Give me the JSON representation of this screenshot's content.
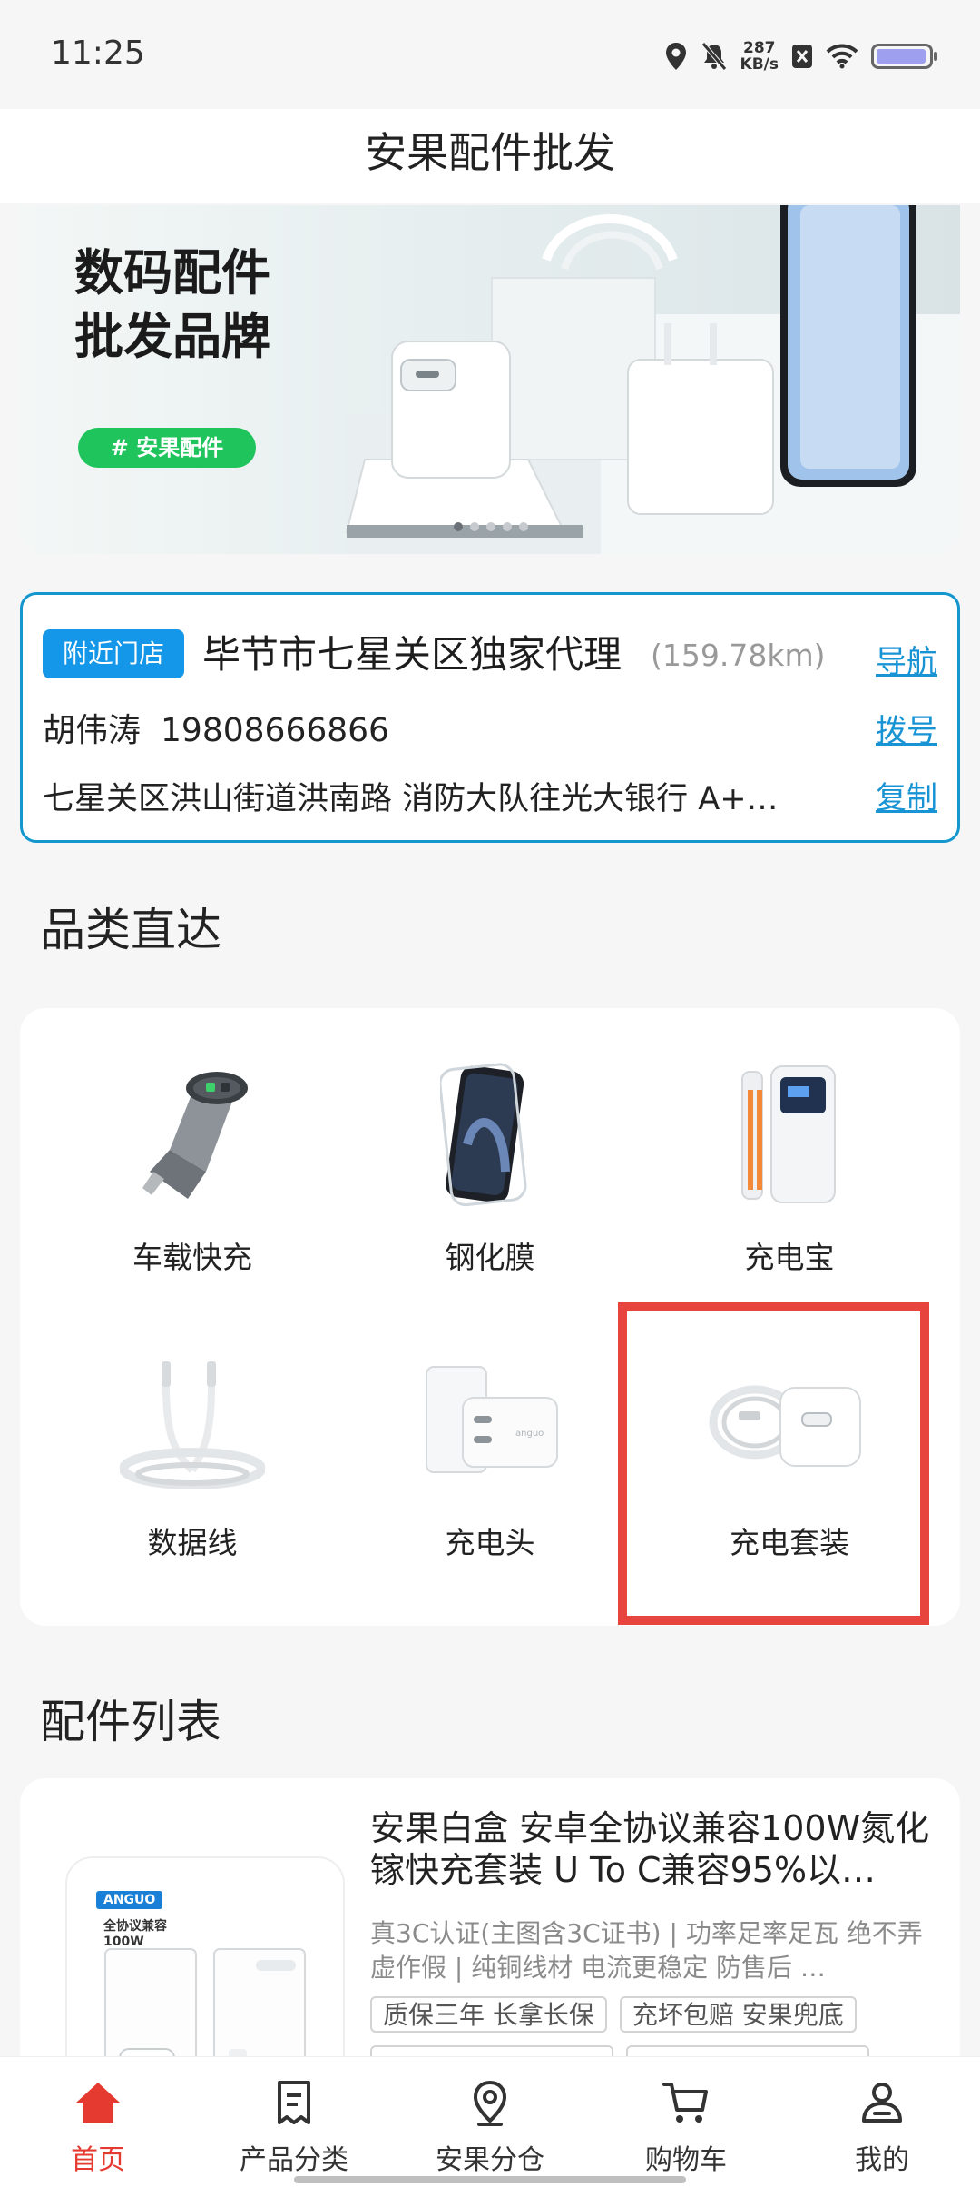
{
  "status_bar": {
    "time": "11:25",
    "speed_value": "287",
    "speed_unit": "KB/s"
  },
  "header": {
    "title": "安果配件批发"
  },
  "banner": {
    "headline": "数码配件\n批发品牌",
    "tag": "# 安果配件",
    "slide_count": 5,
    "active_slide": 1
  },
  "store": {
    "badge": "附近门店",
    "name": "毕节市七星关区独家代理",
    "distance": "(159.78km)",
    "nav_link": "导航",
    "contact_name": "胡伟涛",
    "phone": "19808666866",
    "dial_link": "拨号",
    "address": "七星关区洪山街道洪南路 消防大队往光大银行  A+…",
    "copy_link": "复制"
  },
  "categories": {
    "title": "品类直达",
    "items": [
      {
        "label": "车载快充",
        "icon": "car-charger-icon"
      },
      {
        "label": "钢化膜",
        "icon": "tempered-glass-icon"
      },
      {
        "label": "充电宝",
        "icon": "power-bank-icon"
      },
      {
        "label": "数据线",
        "icon": "data-cable-icon"
      },
      {
        "label": "充电头",
        "icon": "charger-head-icon"
      },
      {
        "label": "充电套装",
        "icon": "charging-set-icon"
      }
    ]
  },
  "products": {
    "title": "配件列表",
    "items": [
      {
        "image_brand": "ANGUO",
        "image_caption": "全协议兼容\n100W",
        "title": "安果白盒 安卓全协议兼容100W氮化镓快充套装 U To C兼容95%以…",
        "desc": "真3C认证(主图含3C证书) | 功率足率足瓦 绝不弄虚作假 | 纯铜线材 电流更稳定 防售后 …",
        "tags": [
          "质保三年 长拿长保",
          "充坏包赔 安果兜底"
        ]
      }
    ]
  },
  "tabbar": {
    "items": [
      {
        "label": "首页",
        "icon": "home-icon",
        "active": true
      },
      {
        "label": "产品分类",
        "icon": "category-icon",
        "active": false
      },
      {
        "label": "安果分仓",
        "icon": "location-icon",
        "active": false
      },
      {
        "label": "购物车",
        "icon": "cart-icon",
        "active": false
      },
      {
        "label": "我的",
        "icon": "profile-icon",
        "active": false
      }
    ]
  },
  "colors": {
    "accent_red": "#e53a30",
    "store_blue": "#1497cf",
    "tag_green": "#1fc45c",
    "highlight_box": "#e8443e"
  }
}
